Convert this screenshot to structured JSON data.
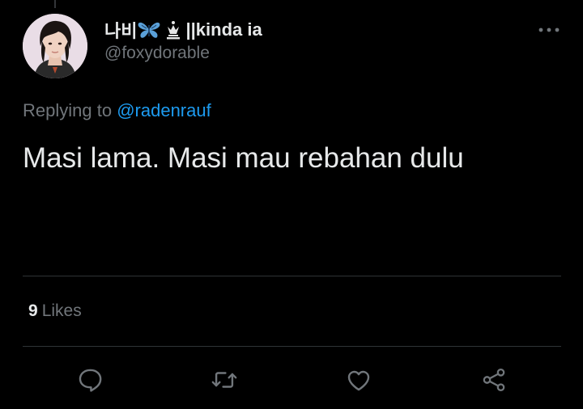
{
  "tweet": {
    "author": {
      "display_name": "나비",
      "display_name_suffix": "||kinda ia",
      "name_icons": [
        "butterfly-icon",
        "chess-queen-icon"
      ],
      "handle": "@foxydorable"
    },
    "replying_to": {
      "prefix": "Replying to",
      "handle": "@radenrauf"
    },
    "text": "Masi lama. Masi mau rebahan dulu",
    "stats": {
      "likes_count": "9",
      "likes_label": "Likes"
    },
    "actions": [
      "reply-icon",
      "retweet-icon",
      "like-icon",
      "share-icon"
    ]
  },
  "colors": {
    "background": "#000000",
    "primary_text": "#e7e9ea",
    "secondary_text": "#71767b",
    "accent": "#1d9bf0",
    "divider": "#2f3336"
  }
}
